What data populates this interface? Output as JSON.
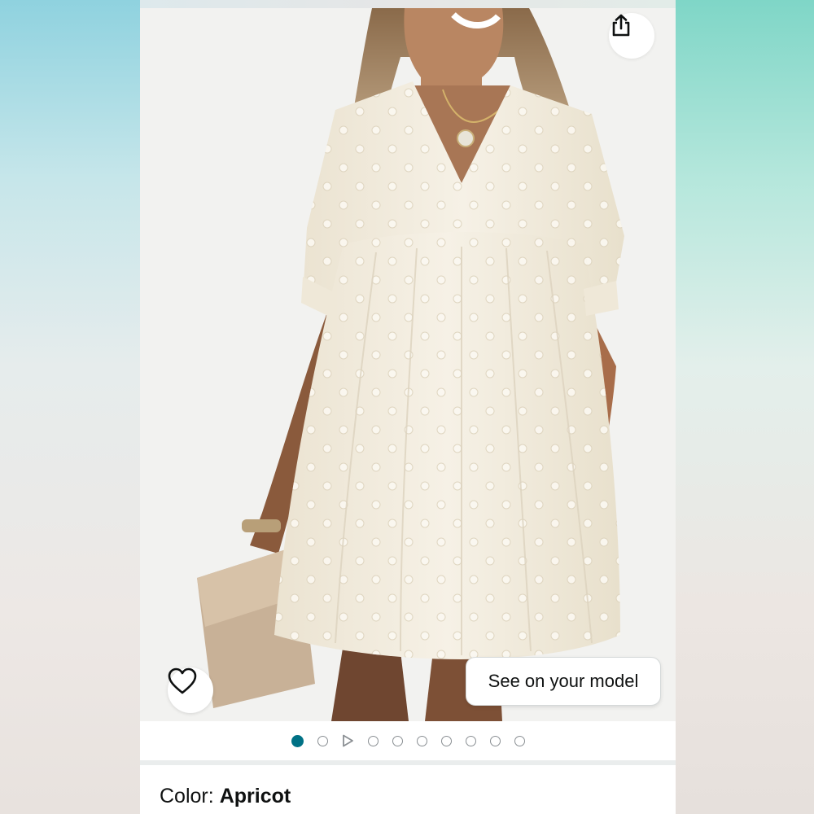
{
  "product_image": {
    "share_icon": "share-icon",
    "wishlist_icon": "heart-outline-icon",
    "see_on_model_label": "See on your model"
  },
  "carousel": {
    "active_index": 0,
    "items": [
      "image",
      "image",
      "video",
      "image",
      "image",
      "image",
      "image",
      "image",
      "image",
      "image"
    ]
  },
  "variation": {
    "label": "Color:",
    "value": "Apricot"
  },
  "colors": {
    "accent": "#007185",
    "text": "#0f1111",
    "dress": "#f1ebdd"
  }
}
